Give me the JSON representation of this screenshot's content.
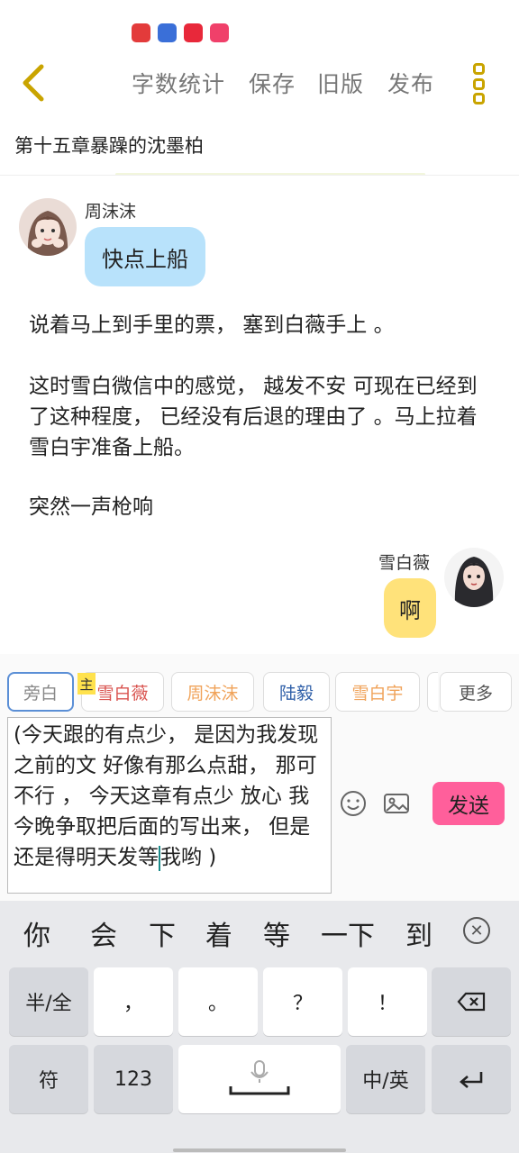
{
  "status_bar": {
    "icons": [
      {
        "name": "app-icon-red-heart",
        "color": "#e33b3b"
      },
      {
        "name": "app-icon-compass",
        "color": "#3a6fd8"
      },
      {
        "name": "app-icon-xiaohongshu",
        "color": "#e8283a"
      },
      {
        "name": "app-icon-video-play",
        "color": "#f0406a"
      }
    ]
  },
  "toolbar": {
    "word_count": "字数统计",
    "save": "保存",
    "old_version": "旧版",
    "publish": "发布"
  },
  "chapter_title": "第十五章暴躁的沈墨柏",
  "chat": {
    "msg1": {
      "name": "周沫沫",
      "text": "快点上船",
      "bubble_color": "#b8e2fb"
    },
    "narration": [
      "说着马上到手里的票， 塞到白薇手上 。",
      "这时雪白微信中的感觉， 越发不安 可现在已经到了这种程度， 已经没有后退的理由了 。马上拉着雪白宇准备上船。",
      "突然一声枪响"
    ],
    "msg2": {
      "name": "雪白薇",
      "text": "啊",
      "bubble_color": "#ffe27a"
    }
  },
  "roles": {
    "main_tag": "主",
    "items": [
      {
        "label": "旁白",
        "color": "#888888",
        "border": "#5b8fd6"
      },
      {
        "label": "雪白薇",
        "color": "#d9534f",
        "border": "#dddddd"
      },
      {
        "label": "周沫沫",
        "color": "#f0a35a",
        "border": "#dddddd"
      },
      {
        "label": "陆毅",
        "color": "#2f5fa8",
        "border": "#dddddd"
      },
      {
        "label": "雪白宇",
        "color": "#f0a35a",
        "border": "#dddddd"
      }
    ],
    "more": "更多"
  },
  "input": {
    "text_before_caret": "(今天跟的有点少， 是因为我发现之前的文 好像有那么点甜， 那可不行 ， 今天这章有点少 放心 我今晚争取把后面的写出来， 但是还是得明天发等",
    "text_after_caret": "我哟 )"
  },
  "send_label": "发送",
  "keyboard": {
    "candidates": [
      "你",
      "会",
      "下",
      "着",
      "等",
      "一下",
      "到"
    ],
    "row1": [
      "半/全",
      "，",
      "。",
      "？",
      "！"
    ],
    "row2": {
      "symbols": "符",
      "numbers": "123",
      "lang": "中/英"
    }
  }
}
